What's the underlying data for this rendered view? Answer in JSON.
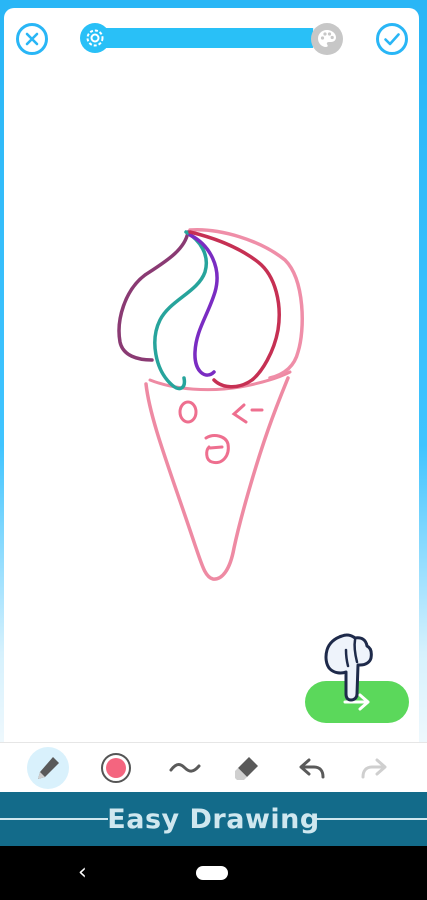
{
  "header": {
    "close_icon": "close-icon",
    "confirm_icon": "check-icon",
    "progress": 0.96,
    "progress_start_icon": "gear-icon",
    "progress_end_icon": "palette-icon"
  },
  "drawing": {
    "subject": "ice-cream-cone",
    "colors": {
      "cone": "#ee8aa3",
      "scoop_outline": "#ef8ea8",
      "swirl_plum": "#8a3a73",
      "swirl_teal": "#27a49c",
      "swirl_purple": "#7a2cc2",
      "swirl_red": "#c63053",
      "face": "#ee6f8f"
    }
  },
  "next_button": {
    "icon": "arrow-right-icon",
    "color": "#5bd85b"
  },
  "toolbar": {
    "tools": [
      {
        "name": "pencil-icon",
        "active": true
      },
      {
        "name": "color-picker-icon",
        "color": "#f4657f"
      },
      {
        "name": "brush-stroke-icon"
      },
      {
        "name": "eraser-icon"
      },
      {
        "name": "undo-icon"
      },
      {
        "name": "redo-icon",
        "disabled": true
      }
    ]
  },
  "banner": {
    "title": "Easy Drawing"
  },
  "system_nav": {
    "back_glyph": "‹"
  }
}
